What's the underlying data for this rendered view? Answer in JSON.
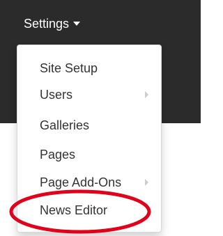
{
  "navbar": {
    "settings_label": "Settings"
  },
  "dropdown": {
    "items": [
      {
        "label": "Site Setup",
        "has_submenu": false
      },
      {
        "label": "Users",
        "has_submenu": true
      },
      {
        "label": "Galleries",
        "has_submenu": false
      },
      {
        "label": "Pages",
        "has_submenu": false
      },
      {
        "label": "Page Add-Ons",
        "has_submenu": true
      },
      {
        "label": "News Editor",
        "has_submenu": false
      }
    ]
  },
  "colors": {
    "navbar_bg": "#2b2b2b",
    "menu_text": "#333333",
    "highlight_oval": "#e0001b"
  },
  "icons": {
    "toggle": "caret-down-icon",
    "submenu": "chevron-right-icon"
  }
}
